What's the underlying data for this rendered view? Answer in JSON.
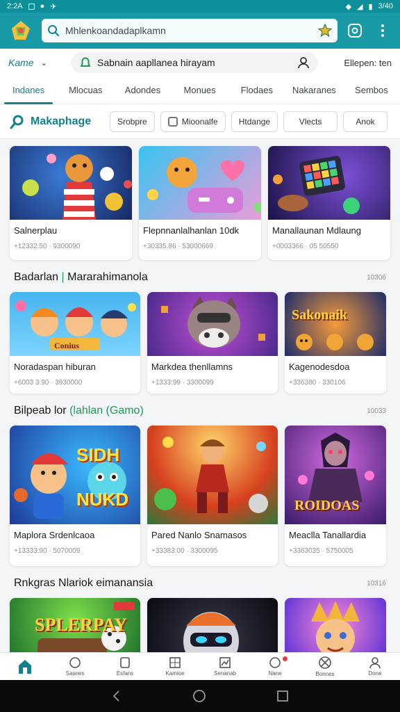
{
  "status": {
    "time": "2:2A",
    "right": "3/40"
  },
  "header": {
    "search_text": "Mhlenkoandadaplkamn"
  },
  "subbar": {
    "home_label": "Kame",
    "address_text": "Sabnain aapllanea hirayam",
    "right_label": "Ellepen: ten"
  },
  "tabs": [
    "Indanes",
    "Mlocuas",
    "Adondes",
    "Monues",
    "Flodaes",
    "Nakaranes",
    "Sembos"
  ],
  "filter": {
    "title": "Makaphage",
    "chips": [
      "Srobpre",
      "Mioonalfe",
      "Htdange",
      "Vlects",
      "Anok"
    ]
  },
  "section1": {
    "cards": [
      {
        "title": "Salnerplau",
        "meta": "+12332:50 · 9300090"
      },
      {
        "title": "Flepnnanlalhanlan 10dk",
        "meta": "+30335.86 · 53000669"
      },
      {
        "title": "Manallaunan Mdlaung",
        "meta": "+0003366 · 05 50550"
      }
    ]
  },
  "section2": {
    "title": "Badarlan",
    "title_accent": "Mararahimanola",
    "count": "10306",
    "cards": [
      {
        "title": "Noradaspan hiburan",
        "meta": "+6003 3:90 · 3930000",
        "overlay": "Conius"
      },
      {
        "title": "Markdea thenllamns",
        "meta": "+1333:99 · 3300099",
        "overlay": ""
      },
      {
        "title": "Kagenodesdoa",
        "meta": "+336380 · 330106",
        "overlay": "Sakonaik"
      }
    ]
  },
  "section3": {
    "title": "Bilpeab lor",
    "title_accent": "(lahlan (Gamo)",
    "count": "10033",
    "cards": [
      {
        "title": "Maplora Srdenlcaoa",
        "meta": "+13333:90 · 5070009",
        "overlay": "SIDH NUKD"
      },
      {
        "title": "Pared Nanlo Snamasos",
        "meta": "+33383:00 · 3300095",
        "overlay": ""
      },
      {
        "title": "Meaclla Tanallardia",
        "meta": "+3363035 · 5750005",
        "overlay": "ROIDOAS"
      }
    ]
  },
  "section4": {
    "title": "Rnkgras Nlariok eimanansia",
    "count": "10316",
    "cards": [
      {
        "overlay": "SPLERPAY"
      },
      {
        "overlay": ""
      },
      {
        "overlay": ""
      }
    ]
  },
  "bottom_nav": [
    "",
    "Sasnes",
    "Esfans",
    "Kamioe",
    "Senanab",
    "Nane",
    "Bonnes",
    "Done"
  ],
  "colors": {
    "primary": "#1a9aa6",
    "accent": "#13808c",
    "green": "#1e9a55"
  }
}
